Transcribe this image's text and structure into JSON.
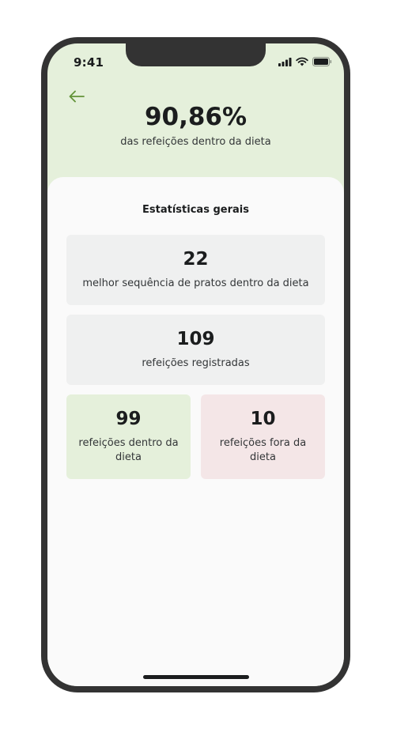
{
  "status_bar": {
    "time": "9:41",
    "icons": [
      "signal-icon",
      "wifi-icon",
      "battery-icon"
    ]
  },
  "header": {
    "back_icon": "arrow-left-icon",
    "percentage": "90,86%",
    "subtitle": "das refeições dentro da dieta"
  },
  "statistics": {
    "title": "Estatísticas gerais",
    "cards": {
      "best_sequence": {
        "value": "22",
        "label": "melhor sequência de pratos dentro da dieta"
      },
      "registered": {
        "value": "109",
        "label": "refeições registradas"
      },
      "in_diet": {
        "value": "99",
        "label": "refeições dentro da dieta"
      },
      "out_diet": {
        "value": "10",
        "label": "refeições fora da dieta"
      }
    }
  },
  "colors": {
    "accent_green": "#639339",
    "green_light": "#e5f0db",
    "red_light": "#f4e6e7",
    "gray_light": "#eff0f0",
    "text_dark": "#1b1d1e"
  }
}
